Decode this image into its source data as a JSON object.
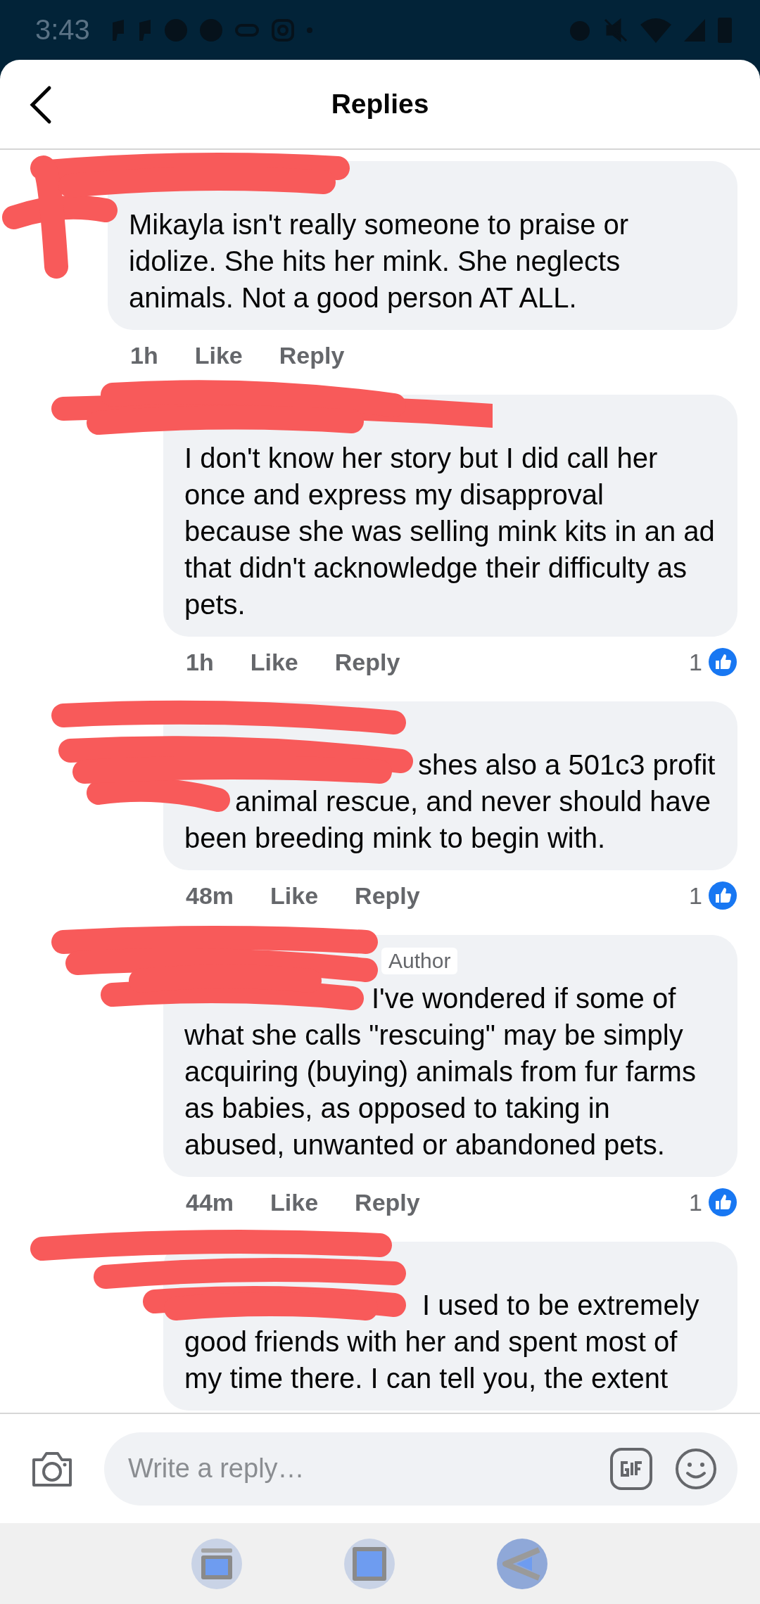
{
  "status_bar": {
    "time": "3:43"
  },
  "header": {
    "title": "Replies"
  },
  "comments": [
    {
      "kind": "comment",
      "body": "Mikayla isn't really someone to praise or idolize. She hits her mink. She neglects animals. Not a good person AT ALL.",
      "time": "1h",
      "like": "Like",
      "reply": "Reply"
    },
    {
      "kind": "reply",
      "body": "I don't know her story but I did call her once and express my disapproval because she was selling mink kits in an ad that didn't acknowledge their difficulty as pets.",
      "time": "1h",
      "like": "Like",
      "reply": "Reply",
      "reactions": "1"
    },
    {
      "kind": "reply",
      "body": "shes also a 501c3 profit animal rescue, and never should have been breeding mink to begin with.",
      "time": "48m",
      "like": "Like",
      "reply": "Reply",
      "reactions": "1"
    },
    {
      "kind": "reply",
      "badge": "Author",
      "body": "I've wondered if some of what she calls \"rescuing\" may be simply acquiring (buying) animals from fur farms as babies, as opposed to taking in abused, unwanted or abandoned pets.",
      "time": "44m",
      "like": "Like",
      "reply": "Reply",
      "reactions": "1"
    },
    {
      "kind": "reply",
      "body": "I used to be extremely good friends with her and spent most of my time there. I can tell you, the extent"
    }
  ],
  "composer": {
    "placeholder": "Write a reply…"
  }
}
